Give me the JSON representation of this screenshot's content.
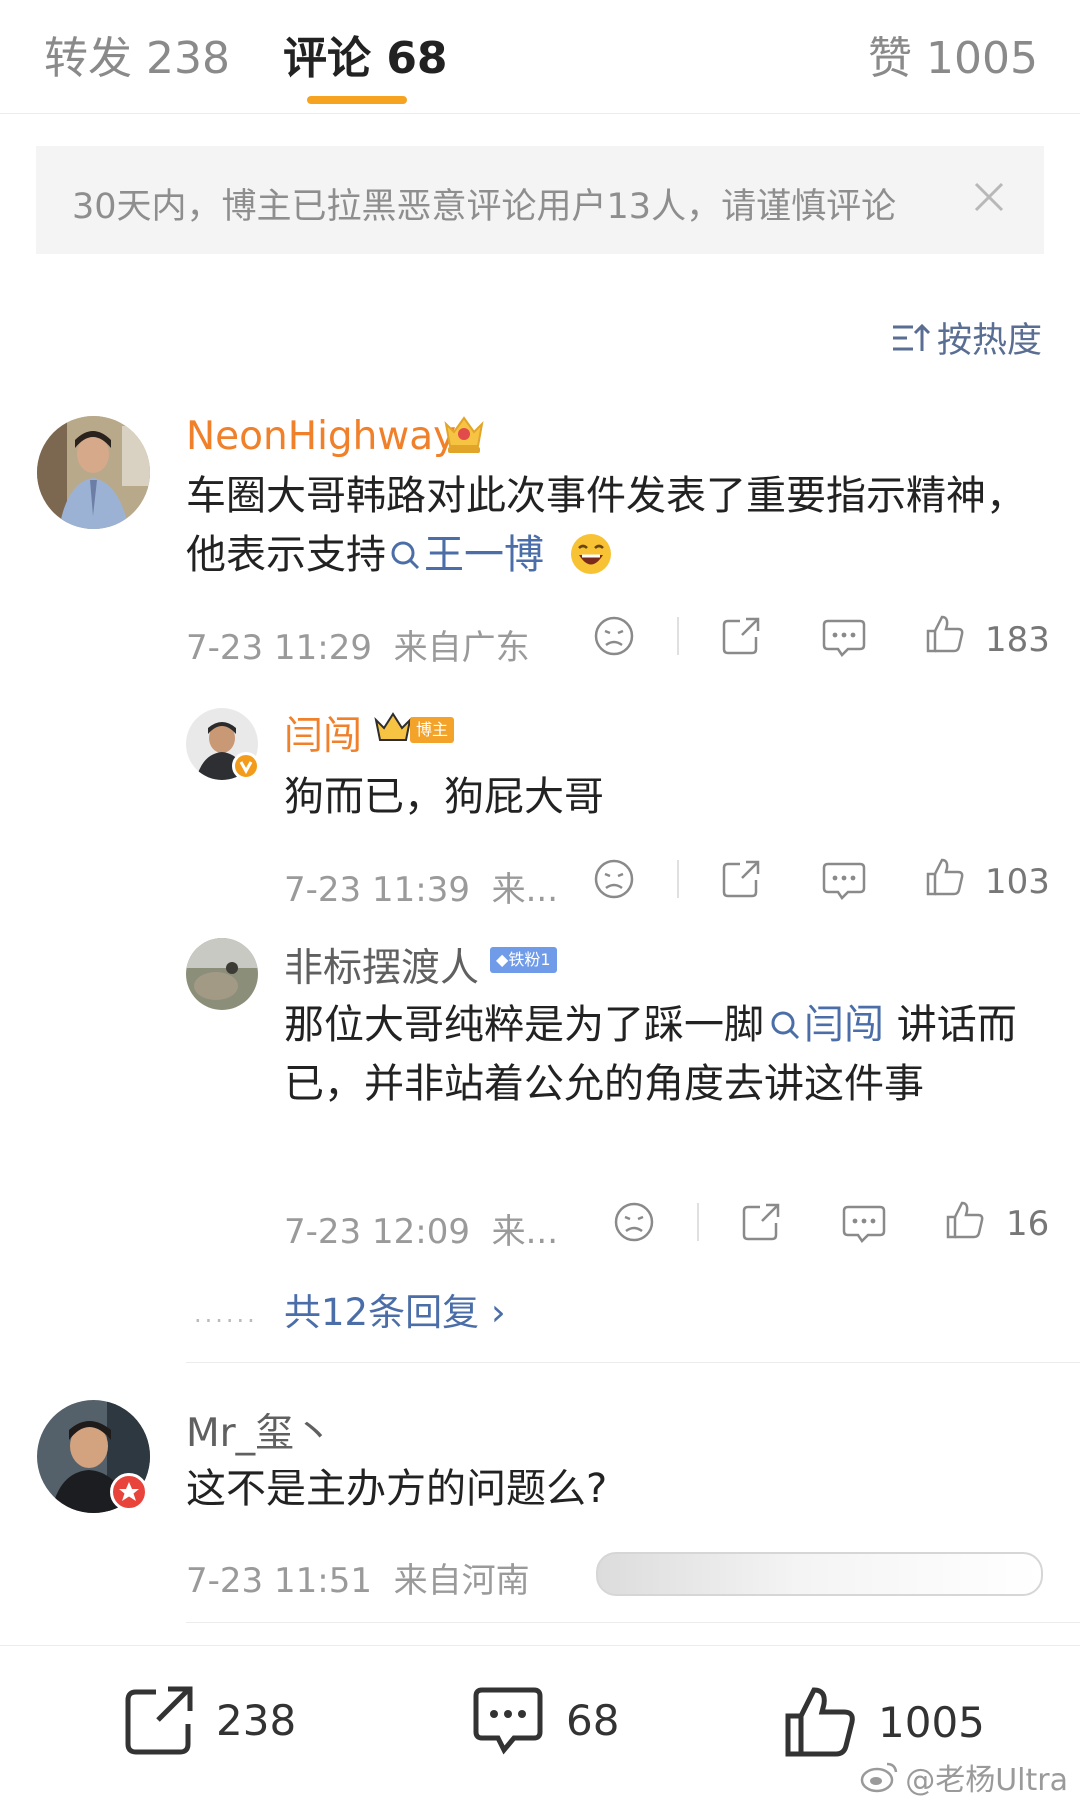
{
  "tabs": {
    "repost": "转发 238",
    "comments": "评论 68",
    "likes": "赞 1005"
  },
  "notice": {
    "text": "30天内，博主已拉黑恶意评论用户13人，请谨慎评论"
  },
  "sort": {
    "label": "按热度"
  },
  "comments": [
    {
      "user": "NeonHighway",
      "text_before": "车圈大哥韩路对此次事件发表了重要指示精神，他表示支持",
      "mention": "王一博",
      "emoji": "laugh-emoji",
      "time": "7-23 11:29",
      "location": "来自广东",
      "likes": "183"
    },
    {
      "user": "闫闯",
      "badge_label": "博主",
      "text": "狗而已，狗屁大哥",
      "time": "7-23 11:39",
      "location": "来...",
      "likes": "103"
    },
    {
      "user": "非标摆渡人",
      "badge_label": "铁粉1",
      "text_before": "那位大哥纯粹是为了踩一脚",
      "mention": "闫闯",
      "text_after": " 讲话而已，并非站着公允的角度去讲这件事",
      "time": "7-23 12:09",
      "location": "来...",
      "likes": "16"
    },
    {
      "user": "Mr_玺丶",
      "text": "这不是主办方的问题么?",
      "time": "7-23 11:51",
      "location": "来自河南"
    }
  ],
  "more_replies": {
    "dots": "......",
    "label": "共12条回复 ›"
  },
  "bottom_bar": {
    "reposts": "238",
    "comments": "68",
    "likes": "1005"
  },
  "watermark": {
    "text": "@老杨Ultra"
  },
  "colors": {
    "accent": "#f7a322",
    "username_orange": "#f0802a",
    "link_blue": "#4b6ea8",
    "notice_bg": "#f4f4f4"
  }
}
